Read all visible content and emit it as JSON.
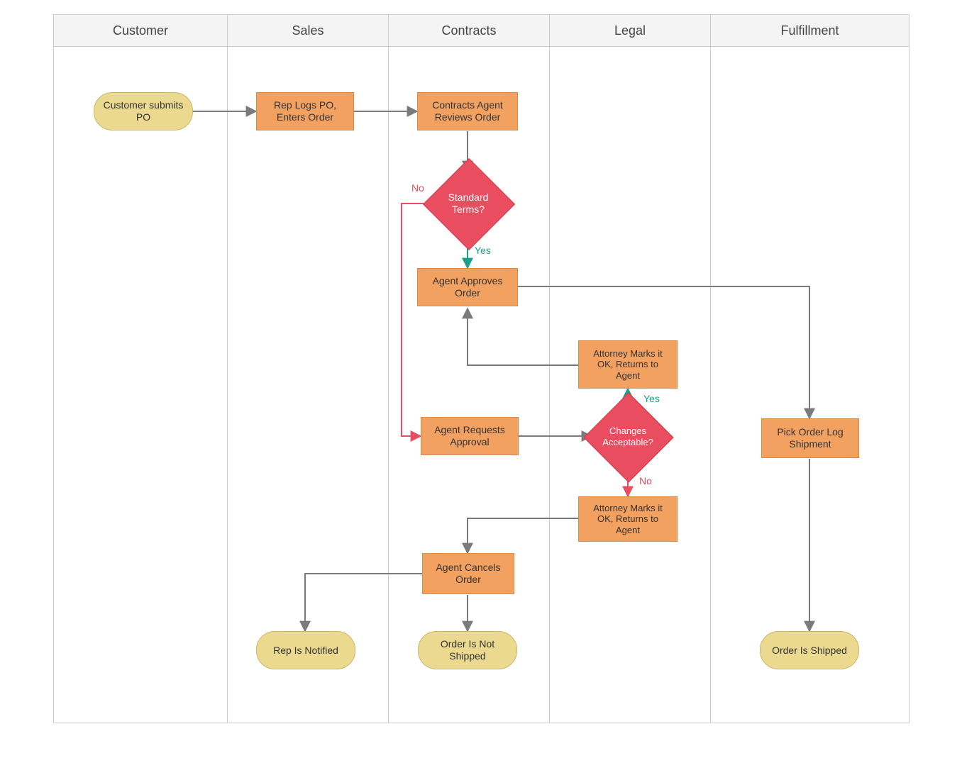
{
  "lanes": {
    "customer": "Customer",
    "sales": "Sales",
    "contracts": "Contracts",
    "legal": "Legal",
    "fulfillment": "Fulfillment"
  },
  "nodes": {
    "start": "Customer submits PO",
    "repLogs": "Rep Logs PO, Enters Order",
    "reviews": "Contracts Agent Reviews Order",
    "standard": "Standard Terms?",
    "approves": "Agent Approves Order",
    "requests": "Agent Requests Approval",
    "changes": "Changes Acceptable?",
    "attorneyOk": "Attorney Marks it OK, Returns to Agent",
    "attorneyOk2": "Attorney Marks it OK, Returns to Agent",
    "cancels": "Agent Cancels Order",
    "repNotified": "Rep Is Notified",
    "notShipped": "Order Is Not Shipped",
    "pick": "Pick Order Log Shipment",
    "shipped": "Order Is Shipped"
  },
  "edgeLabels": {
    "no1": "No",
    "yes1": "Yes",
    "yes2": "Yes",
    "no2": "No"
  }
}
